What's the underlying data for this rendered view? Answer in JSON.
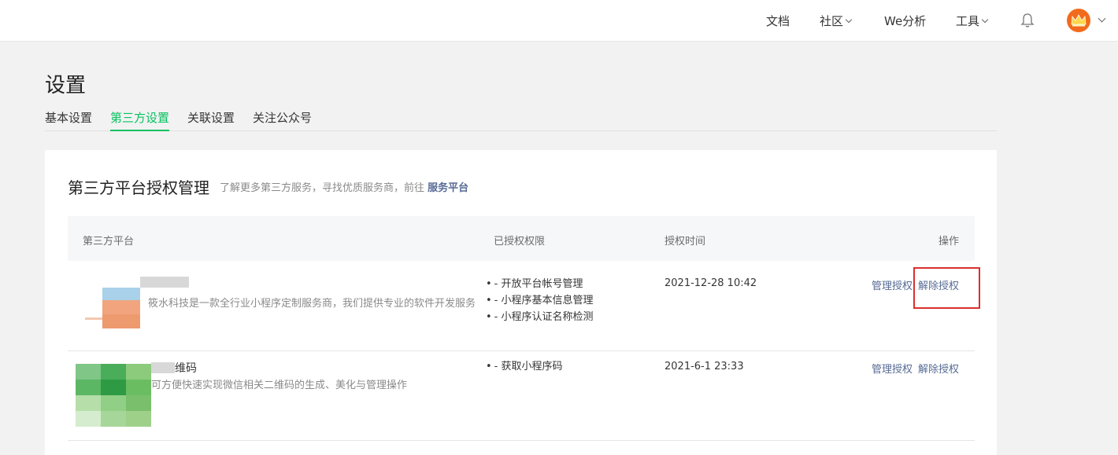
{
  "topbar": {
    "nav": {
      "docs": "文档",
      "community": "社区",
      "we_analysis": "We分析",
      "tools": "工具"
    }
  },
  "page": {
    "title": "设置",
    "tabs": [
      "基本设置",
      "第三方设置",
      "关联设置",
      "关注公众号"
    ],
    "active_tab": "第三方设置"
  },
  "card": {
    "title": "第三方平台授权管理",
    "subtitle": "了解更多第三方服务，寻找优质服务商，前往",
    "subtitle_link": "服务平台",
    "columns": [
      "第三方平台",
      "已授权权限",
      "授权时间",
      "操作"
    ],
    "rows": [
      {
        "name": "",
        "description": "筱水科技是一款全行业小程序定制服务商，我们提供专业的软件开发服务",
        "permissions": [
          "- 开放平台帐号管理",
          "- 小程序基本信息管理",
          "- 小程序认证名称检测"
        ],
        "time": "2021-12-28 10:42",
        "manage": "管理授权",
        "revoke": "解除授权"
      },
      {
        "name": "维码",
        "description": "可方便快速实现微信相关二维码的生成、美化与管理操作",
        "permissions": [
          "- 获取小程序码"
        ],
        "time": "2021-6-1 23:33",
        "manage": "管理授权",
        "revoke": "解除授权"
      }
    ]
  },
  "colors": {
    "accent": "#07c160",
    "link": "#576b95",
    "highlight": "#d9302f"
  },
  "icons": [
    "chevron-down-icon",
    "bell-icon",
    "avatar-crown-icon"
  ]
}
